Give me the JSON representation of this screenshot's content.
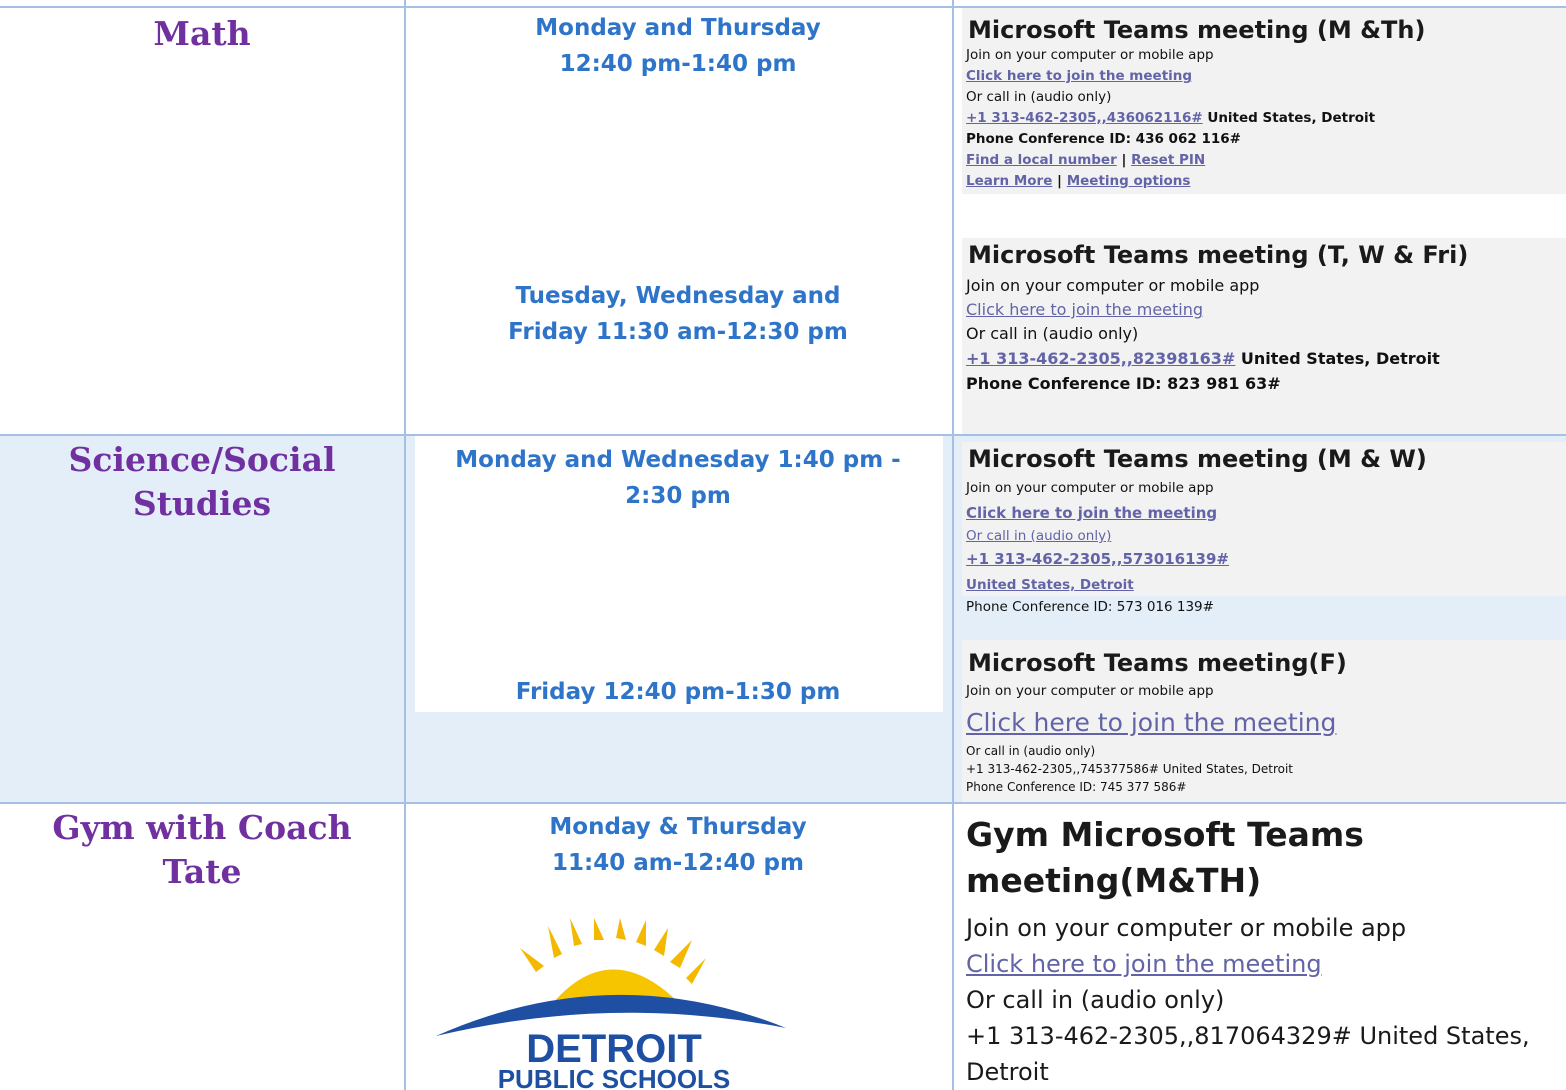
{
  "rows": [
    {
      "subject": "Math",
      "schedules": [
        {
          "lines": [
            "Monday and Thursday",
            "12:40 pm-1:40 pm"
          ]
        },
        {
          "lines": [
            "Tuesday, Wednesday and",
            "Friday 11:30 am-12:30 pm"
          ]
        }
      ],
      "meetings": [
        {
          "title": "Microsoft Teams meeting (M &Th)",
          "join_text": "Join on your computer or mobile app",
          "join_link": "Click here to join the meeting",
          "call_text": "Or call in (audio only)",
          "phone": "+1 313-462-2305,,436062116#",
          "location": " United States, Detroit",
          "conf_id": "Phone Conference ID: 436 062 116#",
          "find_local": "Find a local number",
          "sep": " | ",
          "reset_pin": "Reset PIN",
          "learn_more": "Learn More",
          "meeting_options": "Meeting options"
        },
        {
          "title": "Microsoft Teams meeting (T, W & Fri)",
          "join_text": "Join on your computer or mobile app",
          "join_link": "Click here to join the meeting",
          "call_text": "Or call in (audio only)",
          "phone": "+1 313-462-2305,,82398163#",
          "location": " United States, Detroit",
          "conf_id": "Phone Conference ID: 823 981 63#"
        }
      ]
    },
    {
      "subject_lines": [
        "Science/Social",
        "Studies"
      ],
      "schedules": [
        {
          "lines": [
            "Monday and Wednesday 1:40 pm -",
            "2:30 pm"
          ]
        },
        {
          "lines": [
            "Friday 12:40 pm-1:30 pm"
          ]
        }
      ],
      "meetings": [
        {
          "title": "Microsoft Teams meeting",
          "title_suffix": " (M & W)",
          "join_text": "Join on your computer or mobile app",
          "join_link": "Click here to join the meeting",
          "call_text": "Or call in (audio only)",
          "phone": "+1 313-462-2305,,573016139#",
          "location": "United States, Detroit",
          "conf_id": "Phone Conference ID: 573 016 139#"
        },
        {
          "title": "Microsoft Teams meeting(F)",
          "join_text": "Join on your computer or mobile app",
          "join_link": "Click here to join the meeting",
          "call_text": "Or call in (audio only)",
          "phone_line": "+1 313-462-2305,,745377586# United States, Detroit",
          "conf_id": "Phone Conference ID: 745 377 586#"
        }
      ]
    },
    {
      "subject_lines": [
        "Gym with Coach",
        "Tate"
      ],
      "schedules": [
        {
          "lines": [
            "Monday & Thursday",
            "11:40 am-12:40 pm"
          ]
        }
      ],
      "meetings": [
        {
          "title_lines": [
            "Gym Microsoft Teams",
            "meeting(M&TH)"
          ],
          "join_text": "Join on your computer or mobile app",
          "join_link": "Click here to join the meeting",
          "call_text": "Or call in (audio only)",
          "phone_line1": "+1 313-462-2305,,817064329# United States,",
          "phone_line2": "Detroit"
        }
      ]
    }
  ],
  "logo": {
    "line1": "DETROIT",
    "line2": "PUBLIC SCHOOLS"
  },
  "colors": {
    "subject": "#7030a0",
    "schedule": "#2e74c9",
    "link": "#6264a7",
    "border": "#a6c0e3",
    "band": "#e4eef9"
  }
}
